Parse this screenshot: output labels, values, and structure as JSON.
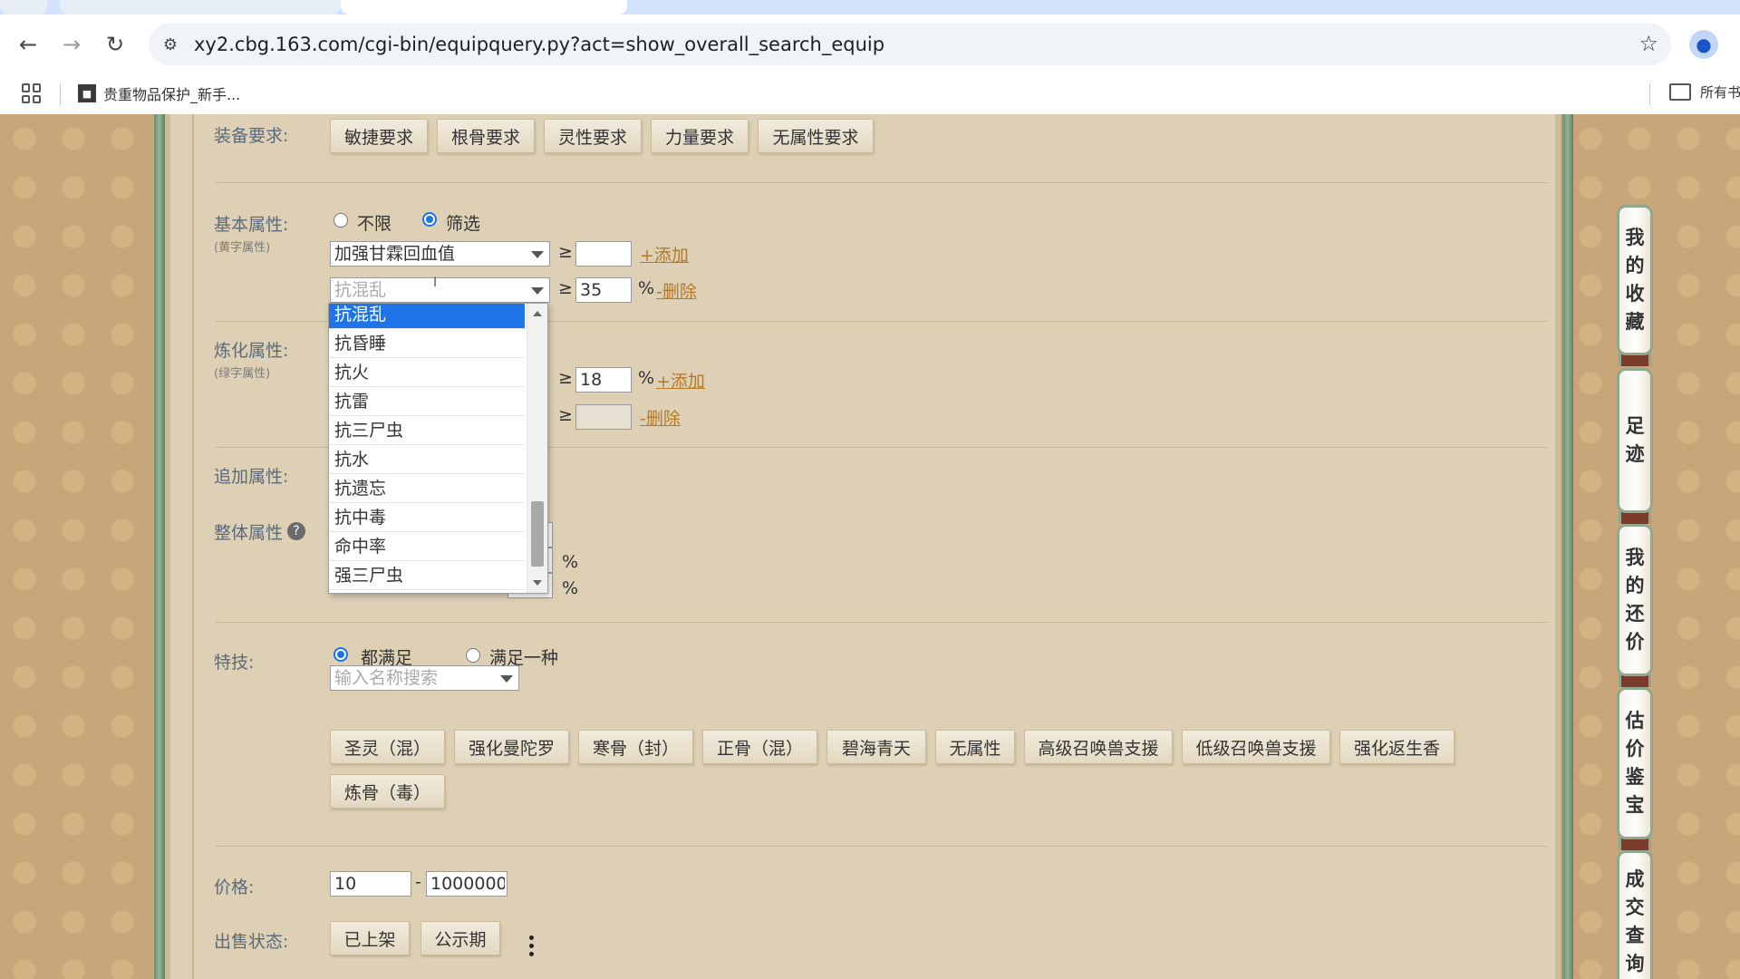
{
  "browser": {
    "url": "xy2.cbg.163.com/cgi-bin/equipquery.py?act=show_overall_search_equip",
    "bookmark": "贵重物品保护_新手...",
    "bookmarks_right": "所有书"
  },
  "equip_req": {
    "label": "装备要求:",
    "buttons": [
      "敏捷要求",
      "根骨要求",
      "灵性要求",
      "力量要求",
      "无属性要求"
    ]
  },
  "basic_attr": {
    "label": "基本属性:",
    "sublabel": "(黄字属性)",
    "radio_any": "不限",
    "radio_filter": "筛选",
    "row1_select": "加强甘霖回血值",
    "row1_ge": "≥",
    "row1_value": "",
    "row1_link": "+添加",
    "row2_select": "抗混乱",
    "row2_ge": "≥",
    "row2_value": "35",
    "row2_pct": "%",
    "row2_link": "-删除"
  },
  "dropdown": {
    "items": [
      "抗混乱",
      "抗昏睡",
      "抗火",
      "抗雷",
      "抗三尸虫",
      "抗水",
      "抗遗忘",
      "抗中毒",
      "命中率",
      "强三尸虫"
    ]
  },
  "refine_attr": {
    "label": "炼化属性:",
    "sublabel": "(绿字属性)",
    "row1_ge": "≥",
    "row1_value": "18",
    "row1_pct": "%",
    "row1_link": "+添加",
    "row2_ge": "≥",
    "row2_value": "",
    "row2_link": "-删除"
  },
  "extra_attr": {
    "label": "追加属性:"
  },
  "overall_attr": {
    "label": "整体属性",
    "help": "?",
    "pct1": "%",
    "pct2": "%"
  },
  "skills": {
    "label": "特技:",
    "radio_all": "都满足",
    "radio_one": "满足一种",
    "search_placeholder": "输入名称搜索",
    "buttons": [
      "圣灵（混）",
      "强化曼陀罗",
      "寒骨（封）",
      "正骨（混）",
      "碧海青天",
      "无属性",
      "高级召唤兽支援",
      "低级召唤兽支援",
      "强化返生香",
      "炼骨（毒）"
    ]
  },
  "price": {
    "label": "价格:",
    "min": "10",
    "sep": "-",
    "max": "1000000"
  },
  "sale_status": {
    "label": "出售状态:",
    "buttons": [
      "已上架",
      "公示期"
    ]
  },
  "side_tabs": [
    {
      "chars": [
        "我",
        "的",
        "收",
        "藏"
      ]
    },
    {
      "chars": [
        "足",
        "迹"
      ]
    },
    {
      "chars": [
        "我",
        "的",
        "还",
        "价"
      ]
    },
    {
      "chars": [
        "估",
        "价",
        "鉴",
        "宝"
      ]
    },
    {
      "chars": [
        "成",
        "交",
        "查",
        "询"
      ]
    }
  ]
}
